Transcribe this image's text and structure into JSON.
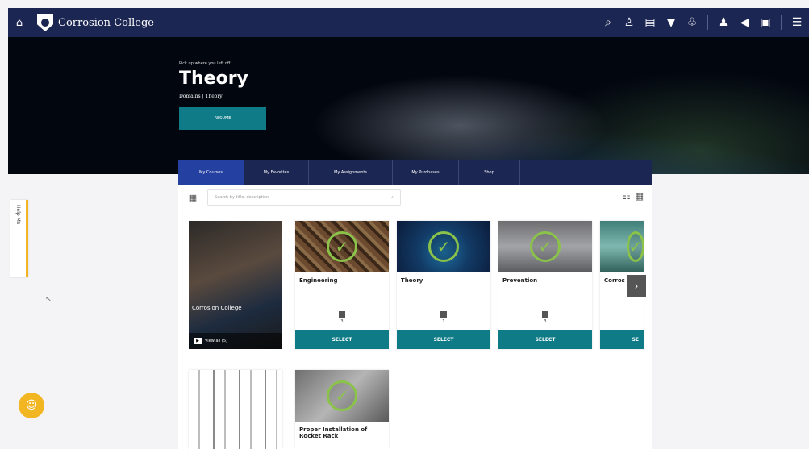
{
  "app": {
    "brand_name": "Corrosion College",
    "colors": {
      "navbar": "#1b2652",
      "accent_teal": "#0e7b86",
      "check_green": "#8bc34a",
      "help_accent": "#f2b623"
    }
  },
  "topbar": {
    "icons": [
      "search-icon",
      "user-upload-icon",
      "certificate-icon",
      "shield-icon",
      "flask-icon",
      "profile-icon",
      "megaphone-icon",
      "wallet-icon",
      "menu-icon"
    ]
  },
  "hero": {
    "eyebrow": "Pick up where you left off",
    "title": "Theory",
    "breadcrumb": "Domains | Theory",
    "button_label": "RESUME"
  },
  "help_tab": {
    "label": "Help Me"
  },
  "tabs": [
    {
      "label": "My Courses",
      "active": true
    },
    {
      "label": "My Favorites",
      "active": false
    },
    {
      "label": "My Assignments",
      "active": false
    },
    {
      "label": "My Purchases",
      "active": false
    },
    {
      "label": "Shop",
      "active": false
    }
  ],
  "toolbar": {
    "search_placeholder": "Search by title, description"
  },
  "promo": {
    "overlay_text": "Corrosion College",
    "video_label": "View all (5)"
  },
  "cards": [
    {
      "title": "Engineering",
      "count": "3",
      "select_label": "SELECT",
      "image": "engineering"
    },
    {
      "title": "Theory",
      "count": "1",
      "select_label": "SELECT",
      "image": "theory"
    },
    {
      "title": "Prevention",
      "count": "3",
      "select_label": "SELECT",
      "image": "prevention"
    },
    {
      "title": "Corros",
      "select_label": "SE",
      "image": "corrosion"
    }
  ],
  "row2_cards": [
    {
      "title": "",
      "image": "structure"
    },
    {
      "title": "Proper Installation of Rocket Rack",
      "image": "rocket-rack"
    }
  ]
}
